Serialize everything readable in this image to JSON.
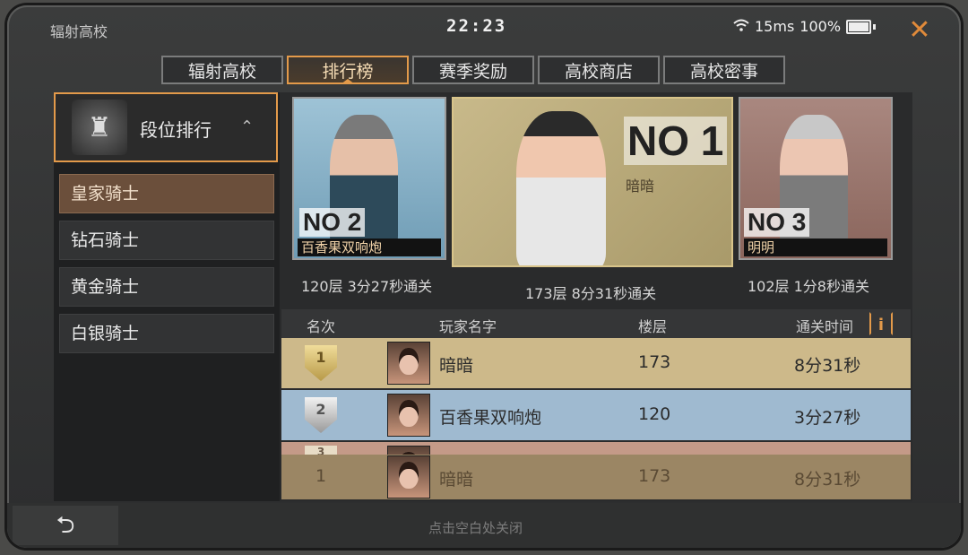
{
  "topbar": {
    "title": "辐射高校",
    "time": "22:23",
    "ping": "15ms",
    "battery": "100%",
    "close_icon": "close-icon"
  },
  "tabs": [
    "辐射高校",
    "排行榜",
    "赛季奖励",
    "高校商店",
    "高校密事"
  ],
  "active_tab": 1,
  "left_menu": {
    "header_title": "段位排行",
    "items": [
      "皇家骑士",
      "钻石骑士",
      "黄金骑士",
      "白银骑士"
    ],
    "active_item": 0
  },
  "podium": {
    "first": {
      "no_label": "NO",
      "rank_digit": "1",
      "name": "暗暗",
      "caption": "173层 8分31秒通关"
    },
    "second": {
      "no_label": "NO",
      "rank_digit": "2",
      "name": "百香果双响炮",
      "caption": "120层 3分27秒通关"
    },
    "third": {
      "no_label": "NO",
      "rank_digit": "3",
      "name": "明明",
      "caption": "102层 1分8秒通关"
    }
  },
  "table": {
    "headers": {
      "rank": "名次",
      "player": "玩家名字",
      "floor": "楼层",
      "time": "通关时间"
    },
    "info_icon": "i",
    "rows": [
      {
        "rank": "1",
        "name": "暗暗",
        "floor": "173",
        "time": "8分31秒"
      },
      {
        "rank": "2",
        "name": "百香果双响炮",
        "floor": "120",
        "time": "3分27秒"
      }
    ],
    "partial_row_rank": "3",
    "my_row": {
      "rank": "1",
      "name": "暗暗",
      "floor": "173",
      "time": "8分31秒"
    }
  },
  "bottom": {
    "back_icon": "⮌",
    "hint": "点击空白处关闭"
  },
  "colors": {
    "accent": "#e39a4a",
    "gold_row": "#cdb98a",
    "silver_row": "#9fbad0",
    "bronze_row": "#c49a88"
  }
}
